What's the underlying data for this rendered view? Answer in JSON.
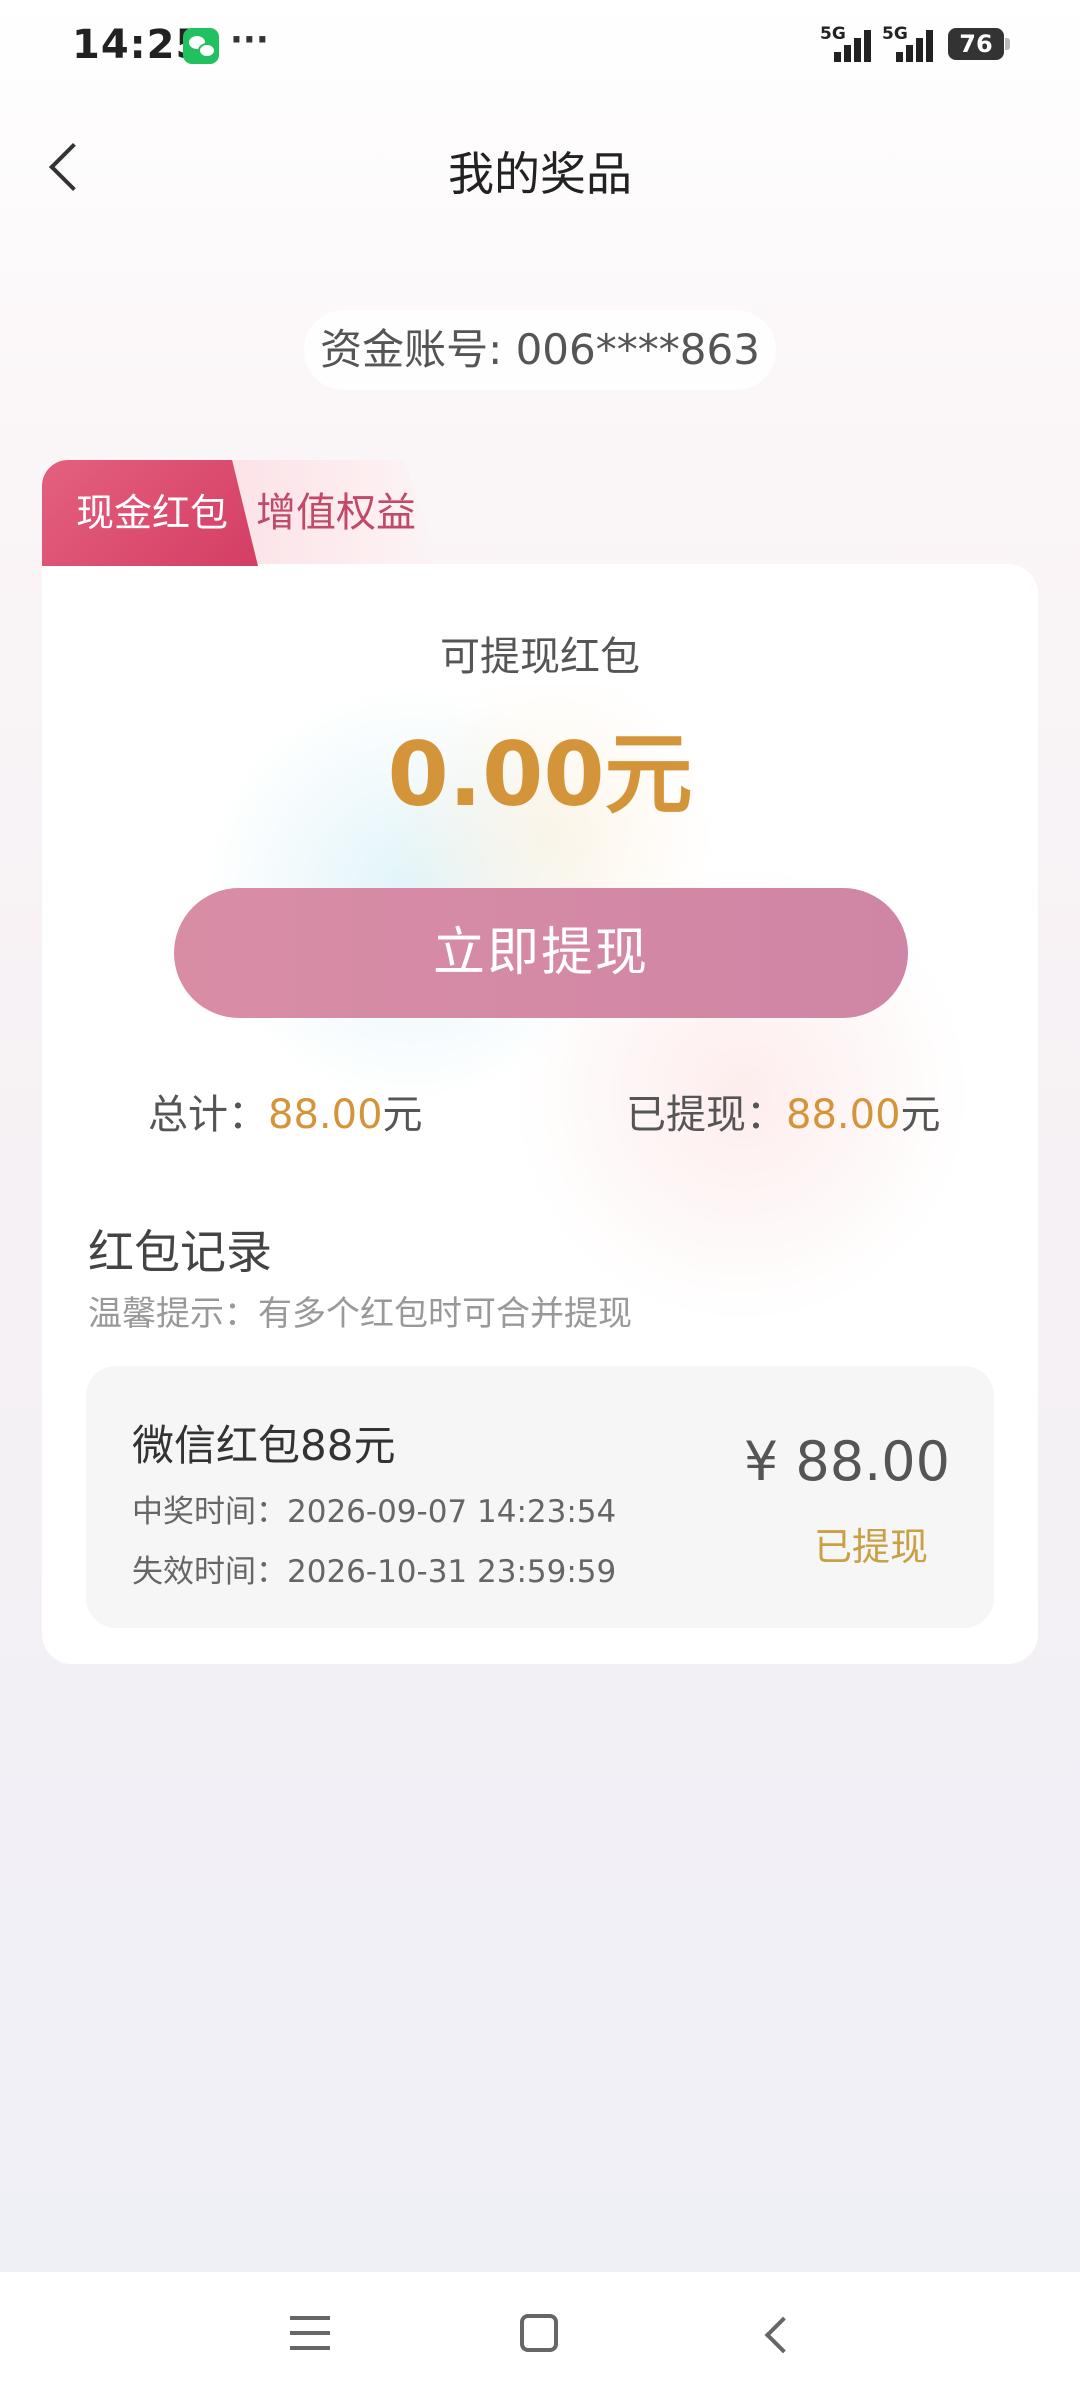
{
  "status_bar": {
    "time": "14:25",
    "dots": "···",
    "network1": "5G",
    "network2": "5G",
    "battery": "76",
    "icons": [
      "wechat-icon",
      "signal-icon",
      "battery-icon"
    ]
  },
  "header": {
    "title": "我的奖品",
    "back_icon": "chevron-left-icon"
  },
  "account": {
    "label": "资金账号: 006****863"
  },
  "tabs": [
    {
      "label": "现金红包",
      "active": true
    },
    {
      "label": "增值权益",
      "active": false
    }
  ],
  "summary": {
    "withdrawable_label": "可提现红包",
    "withdrawable_amount": "0.00元",
    "withdraw_button": "立即提现",
    "total_label": "总计：",
    "total_value": "88.00",
    "total_unit": "元",
    "withdrawn_label": "已提现：",
    "withdrawn_value": "88.00",
    "withdrawn_unit": "元"
  },
  "records": {
    "title": "红包记录",
    "tip": "温馨提示：有多个红包时可合并提现",
    "items": [
      {
        "name": "微信红包88元",
        "win_time": "中奖时间：2026-09-07 14:23:54",
        "expire_time": "失效时间：2026-10-31 23:59:59",
        "amount": "¥ 88.00",
        "status": "已提现"
      }
    ]
  },
  "colors": {
    "accent_gold": "#d4953a",
    "tab_active": "#d43e64",
    "button_pink": "#d98da5",
    "status_gold": "#c9a043"
  },
  "nav_bar": {
    "icons": [
      "menu-icon",
      "home-icon",
      "back-icon"
    ]
  }
}
